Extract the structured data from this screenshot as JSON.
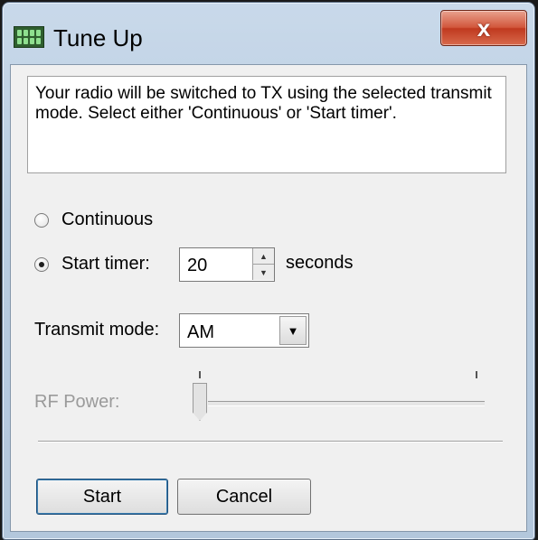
{
  "window": {
    "title": "Tune Up",
    "close_label": "x"
  },
  "message": {
    "text": "Your radio will be switched to TX using the selected transmit mode. Select either 'Continuous' or 'Start timer'."
  },
  "options": {
    "continuous_label": "Continuous",
    "continuous_selected": false,
    "start_timer_label": "Start timer:",
    "start_timer_selected": true,
    "timer_value": "20",
    "timer_unit": "seconds"
  },
  "transmit_mode": {
    "label": "Transmit mode:",
    "selected": "AM"
  },
  "rf_power": {
    "label": "RF Power:",
    "enabled": false,
    "level_fraction": 0.0
  },
  "buttons": {
    "start": "Start",
    "cancel": "Cancel"
  },
  "icons": {
    "app": "radio-app-icon",
    "close": "close-icon",
    "spin_up": "spin-up-icon",
    "spin_down": "spin-down-icon",
    "dropdown": "chevron-down-icon"
  },
  "colors": {
    "title_bar": "#c9d9ea",
    "close_button": "#c0391f",
    "client_bg": "#f0f0f0",
    "disabled_text": "#9a9a9a"
  }
}
